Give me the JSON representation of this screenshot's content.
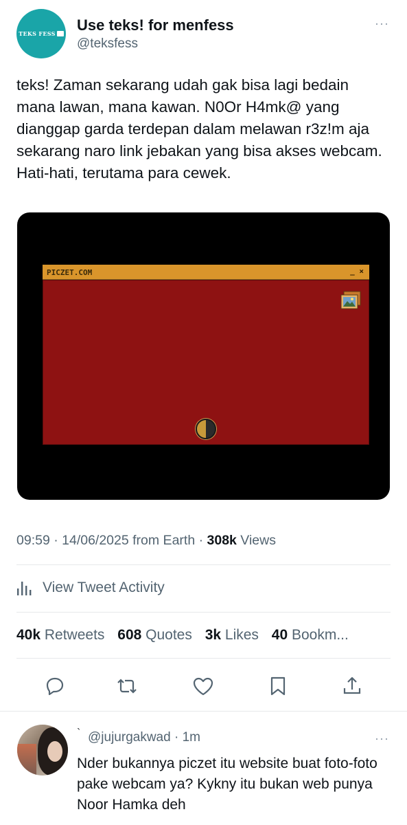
{
  "author": {
    "avatar_text": "TEKS FESS",
    "name": "Use teks! for menfess",
    "handle": "@teksfess",
    "more": "···"
  },
  "tweet": {
    "text": "teks! Zaman sekarang udah gak bisa lagi bedain mana lawan, mana kawan. N0Or H4mk@ yang dianggap garda terdepan dalam melawan r3z!m aja sekarang naro link jebakan yang bisa akses webcam. Hati-hati, terutama para cewek."
  },
  "media": {
    "window_title": "PICZET.COM",
    "window_controls": "_ ×",
    "body_color": "#8e1212",
    "bar_color": "#d9952b"
  },
  "meta": {
    "time_date": "09:59 · 14/06/2025 from Earth · ",
    "views_count": "308k",
    "views_label": " Views"
  },
  "activity": {
    "label": "View Tweet Activity",
    "icon": "bar-chart-icon"
  },
  "stats": {
    "retweets_count": "40k",
    "retweets_label": " Retweets",
    "quotes_count": "608",
    "quotes_label": " Quotes",
    "likes_count": "3k",
    "likes_label": " Likes",
    "bookmarks_count": "40",
    "bookmarks_label": " Bookm..."
  },
  "actions": [
    "reply-icon",
    "retweet-icon",
    "like-icon",
    "bookmark-icon",
    "share-icon"
  ],
  "reply": {
    "prefix": "`",
    "handle_time": "@jujurgakwad · 1m",
    "more": "···",
    "text": "Nder bukannya piczet itu website buat foto-foto pake webcam ya? Kykny itu bukan web punya Noor Hamka deh"
  },
  "colors": {
    "secondary_text": "#536471",
    "primary_text": "#0f1419",
    "avatar_teal": "#1aa5a8"
  }
}
